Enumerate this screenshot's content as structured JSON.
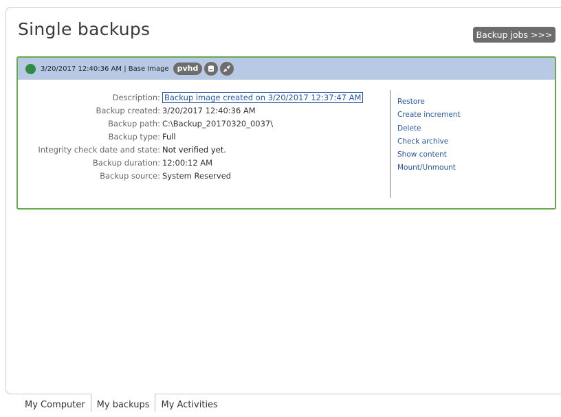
{
  "page_title": "Single backups",
  "backup_jobs_button": "Backup jobs >>>",
  "card": {
    "header_text": "3/20/2017 12:40:36 AM | Base Image",
    "format_badge": "pvhd",
    "status_color": "#2f8b45",
    "header_icons": [
      "disk-icon",
      "compress-icon"
    ],
    "details": [
      {
        "label": "Description:",
        "value": "Backup image created on 3/20/2017 12:37:47 AM"
      },
      {
        "label": "Backup created:",
        "value": "3/20/2017 12:40:36 AM"
      },
      {
        "label": "Backup path:",
        "value": "C:\\Backup_20170320_0037\\"
      },
      {
        "label": "Backup type:",
        "value": "Full"
      },
      {
        "label": "Integrity check date and state:",
        "value": "Not verified yet."
      },
      {
        "label": "Backup duration:",
        "value": "12:00:12 AM"
      },
      {
        "label": "Backup source:",
        "value": "System Reserved"
      }
    ],
    "actions": [
      "Restore",
      "Create increment",
      "Delete",
      "Check archive",
      "Show content",
      "Mount/Unmount"
    ]
  },
  "tabs": [
    {
      "label": "My Computer",
      "active": false
    },
    {
      "label": "My backups",
      "active": true
    },
    {
      "label": "My Activities",
      "active": false
    }
  ],
  "colors": {
    "accent_border": "#6aa84f",
    "header_bg": "#b8c9e6",
    "link": "#2557a0"
  }
}
